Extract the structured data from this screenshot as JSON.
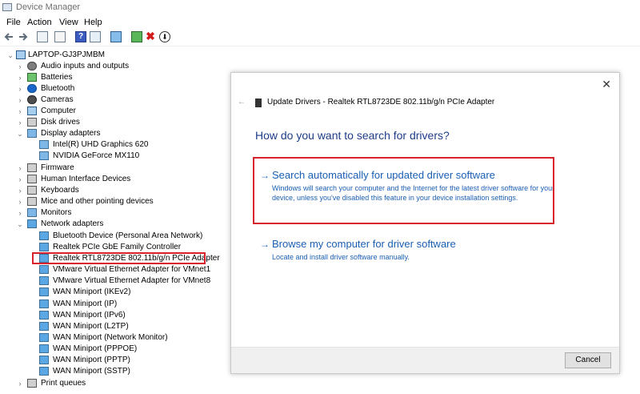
{
  "window": {
    "title": "Device Manager"
  },
  "menu": [
    "File",
    "Action",
    "View",
    "Help"
  ],
  "tree": {
    "root": "LAPTOP-GJ3PJMBM",
    "categories": [
      {
        "label": "Audio inputs and outputs",
        "icon": "speaker-icon",
        "expanded": false
      },
      {
        "label": "Batteries",
        "icon": "battery-icon",
        "expanded": false
      },
      {
        "label": "Bluetooth",
        "icon": "bluetooth-icon",
        "expanded": false
      },
      {
        "label": "Cameras",
        "icon": "camera-icon",
        "expanded": false
      },
      {
        "label": "Computer",
        "icon": "computer-icon",
        "expanded": false
      },
      {
        "label": "Disk drives",
        "icon": "disk-drive-icon",
        "expanded": false
      },
      {
        "label": "Display adapters",
        "icon": "display-adapter-icon",
        "expanded": true,
        "children": [
          "Intel(R) UHD Graphics 620",
          "NVIDIA GeForce MX110"
        ]
      },
      {
        "label": "Firmware",
        "icon": "firmware-icon",
        "expanded": false
      },
      {
        "label": "Human Interface Devices",
        "icon": "hid-icon",
        "expanded": false
      },
      {
        "label": "Keyboards",
        "icon": "keyboard-icon",
        "expanded": false
      },
      {
        "label": "Mice and other pointing devices",
        "icon": "mouse-icon",
        "expanded": false
      },
      {
        "label": "Monitors",
        "icon": "monitor-icon",
        "expanded": false
      },
      {
        "label": "Network adapters",
        "icon": "network-adapter-icon",
        "expanded": true,
        "children": [
          "Bluetooth Device (Personal Area Network)",
          "Realtek PCIe GbE Family Controller",
          "Realtek RTL8723DE 802.11b/g/n PCIe Adapter",
          "VMware Virtual Ethernet Adapter for VMnet1",
          "VMware Virtual Ethernet Adapter for VMnet8",
          "WAN Miniport (IKEv2)",
          "WAN Miniport (IP)",
          "WAN Miniport (IPv6)",
          "WAN Miniport (L2TP)",
          "WAN Miniport (Network Monitor)",
          "WAN Miniport (PPPOE)",
          "WAN Miniport (PPTP)",
          "WAN Miniport (SSTP)"
        ]
      },
      {
        "label": "Print queues",
        "icon": "printer-icon",
        "expanded": false
      }
    ]
  },
  "dialog": {
    "header": "Update Drivers - Realtek RTL8723DE 802.11b/g/n PCIe Adapter",
    "question": "How do you want to search for drivers?",
    "option_auto": {
      "title": "Search automatically for updated driver software",
      "desc": "Windows will search your computer and the Internet for the latest driver software for your device, unless you've disabled this feature in your device installation settings."
    },
    "option_browse": {
      "title": "Browse my computer for driver software",
      "desc": "Locate and install driver software manually."
    },
    "cancel": "Cancel"
  },
  "colors": {
    "highlight": "#d9222c",
    "link": "#1a5fb4",
    "heading": "#1f3c88"
  }
}
